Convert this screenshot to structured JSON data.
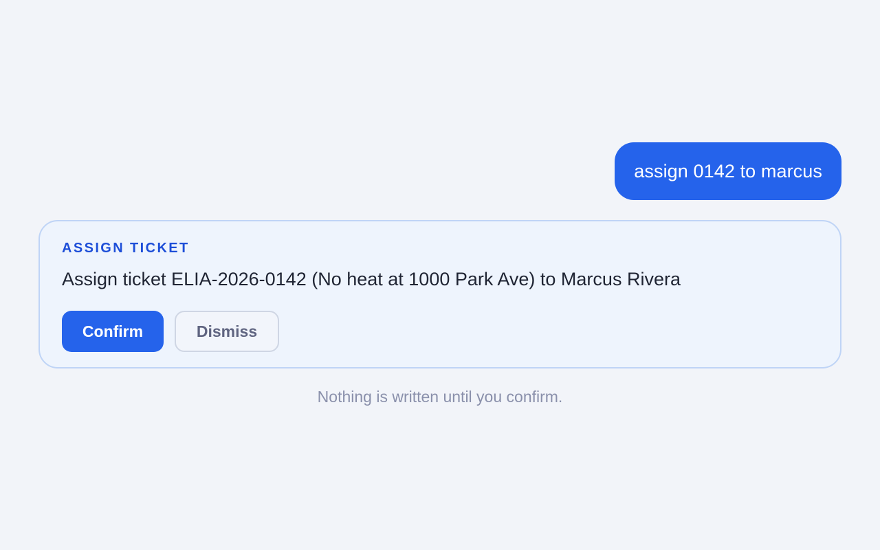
{
  "conversation": {
    "user_message": "assign 0142 to marcus"
  },
  "action_card": {
    "kicker": "ASSIGN TICKET",
    "summary": "Assign ticket ELIA-2026-0142 (No heat at 1000 Park Ave) to Marcus Rivera",
    "confirm_label": "Confirm",
    "dismiss_label": "Dismiss"
  },
  "footnote": "Nothing is written until you confirm.",
  "colors": {
    "accent": "#2563eb",
    "kicker": "#1d4ed8",
    "card_background": "#eef4fd",
    "card_border": "#bfd4f6",
    "page_background": "#f2f4f9",
    "muted_text": "#8a90ab"
  }
}
